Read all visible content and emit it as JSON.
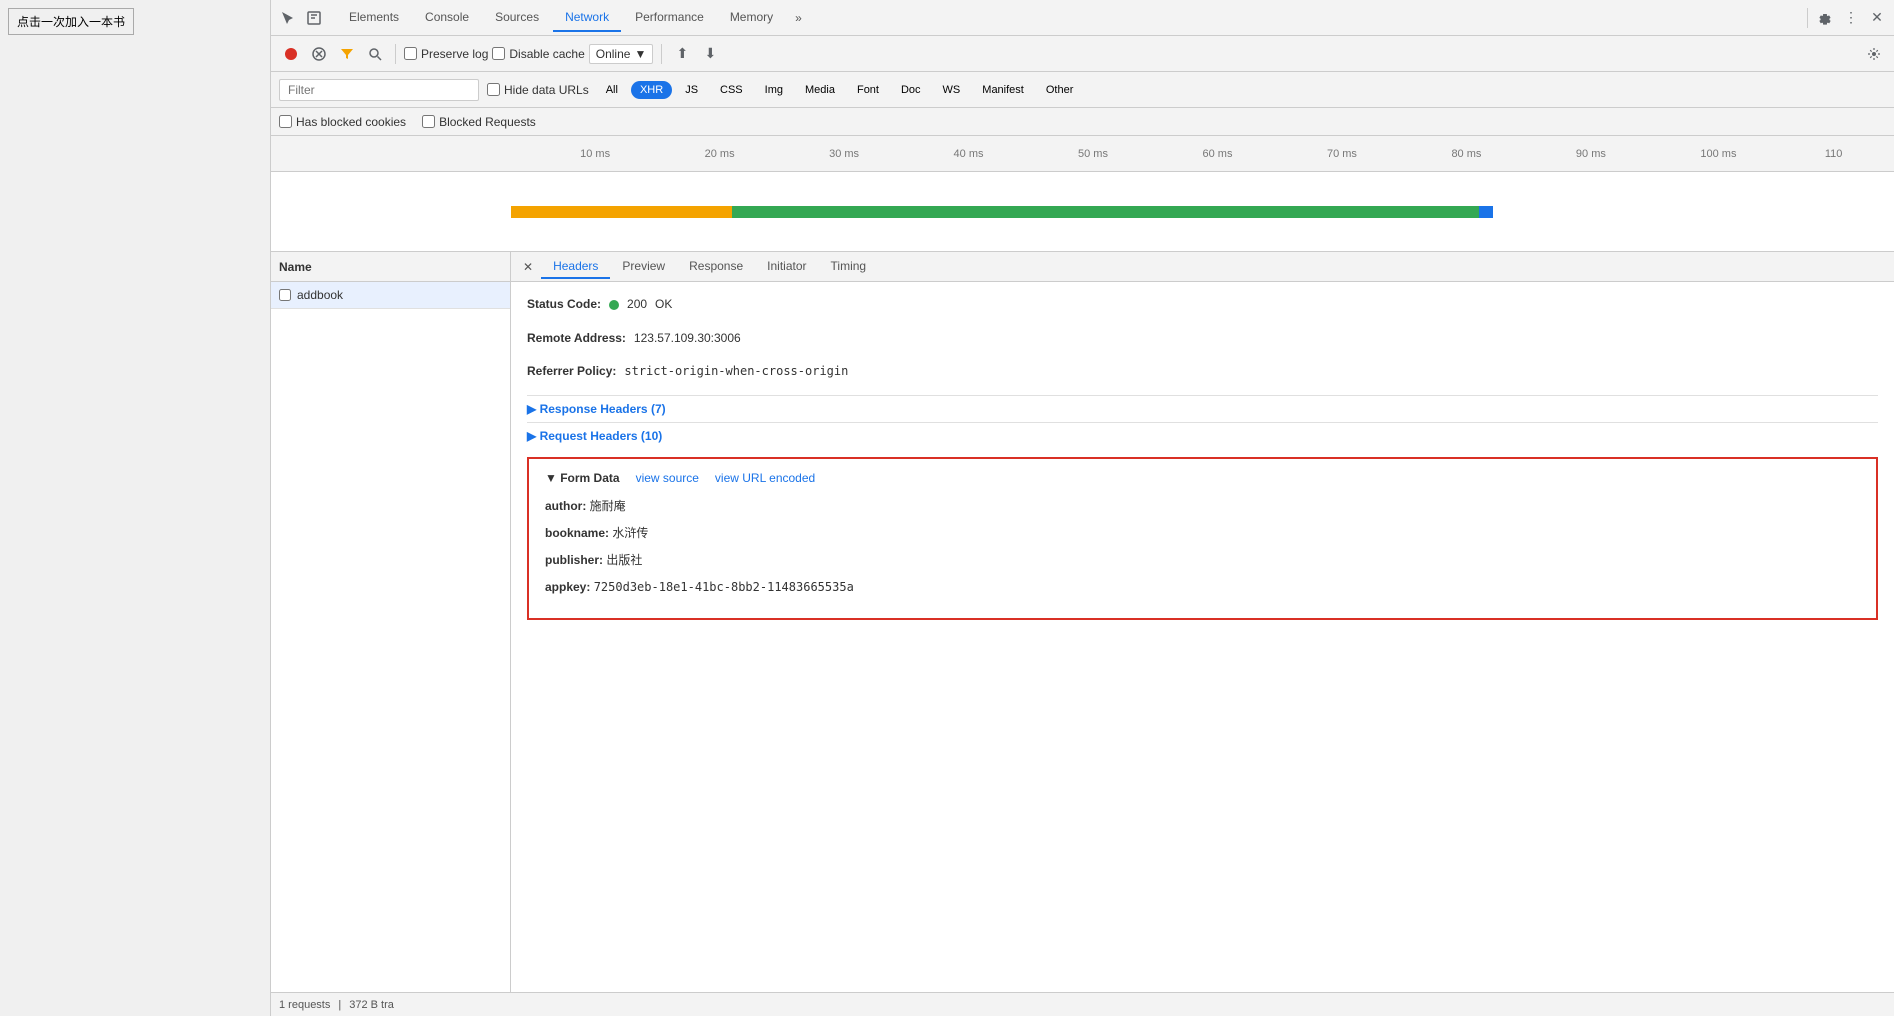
{
  "page": {
    "button_label": "点击一次加入一本书"
  },
  "devtools": {
    "tabs": [
      {
        "id": "elements",
        "label": "Elements",
        "active": false
      },
      {
        "id": "console",
        "label": "Console",
        "active": false
      },
      {
        "id": "sources",
        "label": "Sources",
        "active": false
      },
      {
        "id": "network",
        "label": "Network",
        "active": true
      },
      {
        "id": "performance",
        "label": "Performance",
        "active": false
      },
      {
        "id": "memory",
        "label": "Memory",
        "active": false
      }
    ],
    "more_label": "»",
    "toolbar": {
      "preserve_log": "Preserve log",
      "disable_cache": "Disable cache",
      "online": "Online"
    },
    "filter": {
      "placeholder": "Filter",
      "hide_data_urls": "Hide data URLs",
      "types": [
        "All",
        "XHR",
        "JS",
        "CSS",
        "Img",
        "Media",
        "Font",
        "Doc",
        "WS",
        "Manifest",
        "Other"
      ],
      "active_type": "XHR"
    },
    "cookie_bar": {
      "has_blocked_cookies": "Has blocked cookies",
      "blocked_requests": "Blocked Requests"
    },
    "timeline": {
      "ticks": [
        "10 ms",
        "20 ms",
        "30 ms",
        "40 ms",
        "50 ms",
        "60 ms",
        "70 ms",
        "80 ms",
        "90 ms",
        "100 ms",
        "110"
      ]
    },
    "left_panel": {
      "column_name": "Name",
      "request": {
        "name": "addbook",
        "checkbox": false
      }
    },
    "right_panel": {
      "tabs": [
        "Headers",
        "Preview",
        "Response",
        "Initiator",
        "Timing"
      ],
      "active_tab": "Headers",
      "headers": {
        "status_code_label": "Status Code:",
        "status_dot_color": "#34a853",
        "status_code": "200",
        "status_text": "OK",
        "remote_address_label": "Remote Address:",
        "remote_address": "123.57.109.30:3006",
        "referrer_policy_label": "Referrer Policy:",
        "referrer_policy": "strict-origin-when-cross-origin",
        "response_headers_label": "▶ Response Headers (7)",
        "request_headers_label": "▶ Request Headers (10)",
        "form_data": {
          "title": "▼ Form Data",
          "view_source": "view source",
          "view_url_encoded": "view URL encoded",
          "fields": [
            {
              "key": "author:",
              "value": "施耐庵"
            },
            {
              "key": "bookname:",
              "value": "水浒传"
            },
            {
              "key": "publisher:",
              "value": "出版社"
            },
            {
              "key": "appkey:",
              "value": "7250d3eb-18e1-41bc-8bb2-11483665535a"
            }
          ]
        }
      }
    },
    "status_bar": {
      "requests": "1 requests",
      "transferred": "372 B tra"
    }
  }
}
